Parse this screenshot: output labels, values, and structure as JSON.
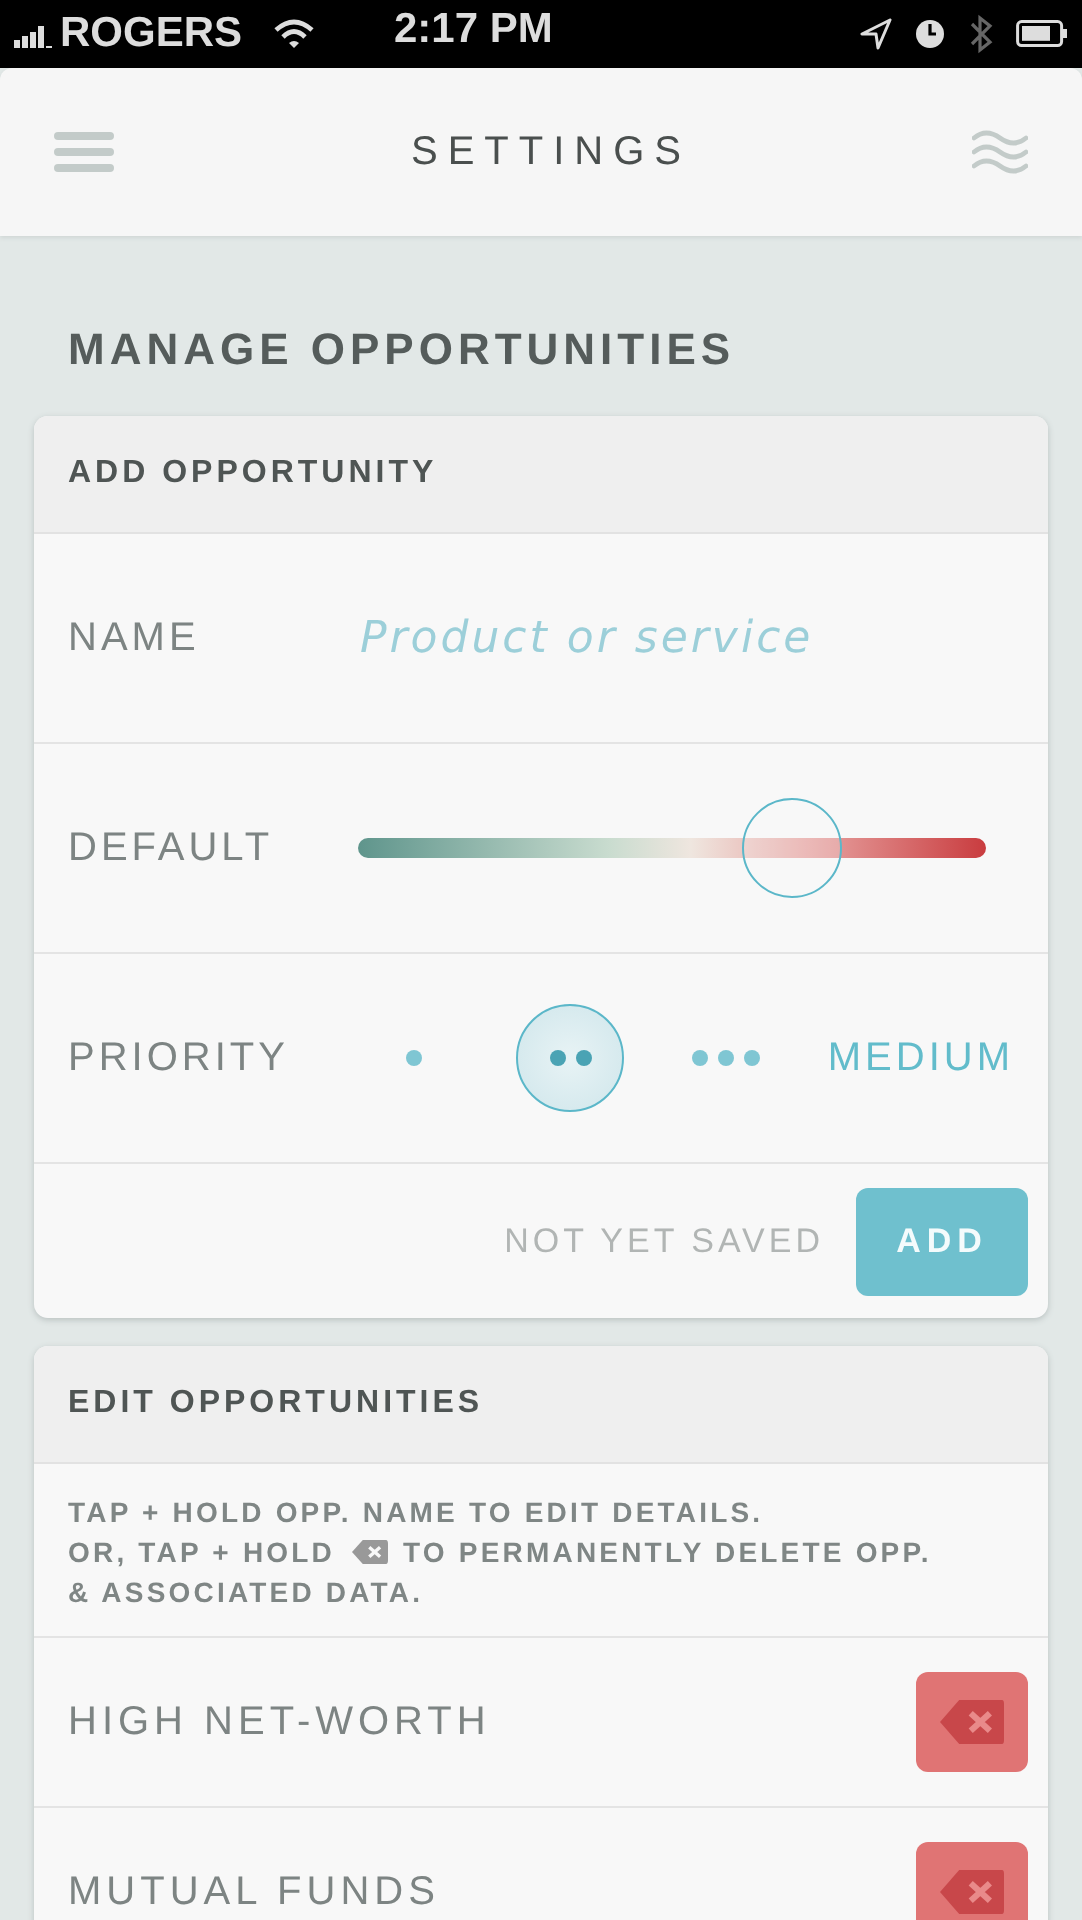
{
  "status_bar": {
    "carrier": "ROGERS",
    "time": "2:17 PM"
  },
  "nav": {
    "title": "SETTINGS"
  },
  "section_title": "MANAGE OPPORTUNITIES",
  "add_card": {
    "title": "ADD OPPORTUNITY",
    "name_field": {
      "label": "NAME",
      "placeholder": "Product or service"
    },
    "default_slider": {
      "label": "DEFAULT",
      "level": 0.69
    },
    "priority": {
      "label": "PRIORITY",
      "options": [
        {
          "selected": false
        },
        {
          "selected": true
        },
        {
          "selected": false
        }
      ],
      "value": "MEDIUM"
    },
    "save_status": "NOT YET SAVED",
    "button": "ADD"
  },
  "edit_card": {
    "title": "EDIT OPPORTUNITIES",
    "help": {
      "line_1": "TAP + HOLD OPP. NAME TO EDIT DETAILS.",
      "line_2_before": "OR, TAP + HOLD",
      "line_2_after": "TO PERMANENTLY DELETE OPP.",
      "line_3": "& ASSOCIATED DATA."
    },
    "items": [
      {
        "name": "HIGH NET-WORTH"
      },
      {
        "name": "MUTUAL FUNDS"
      }
    ]
  }
}
